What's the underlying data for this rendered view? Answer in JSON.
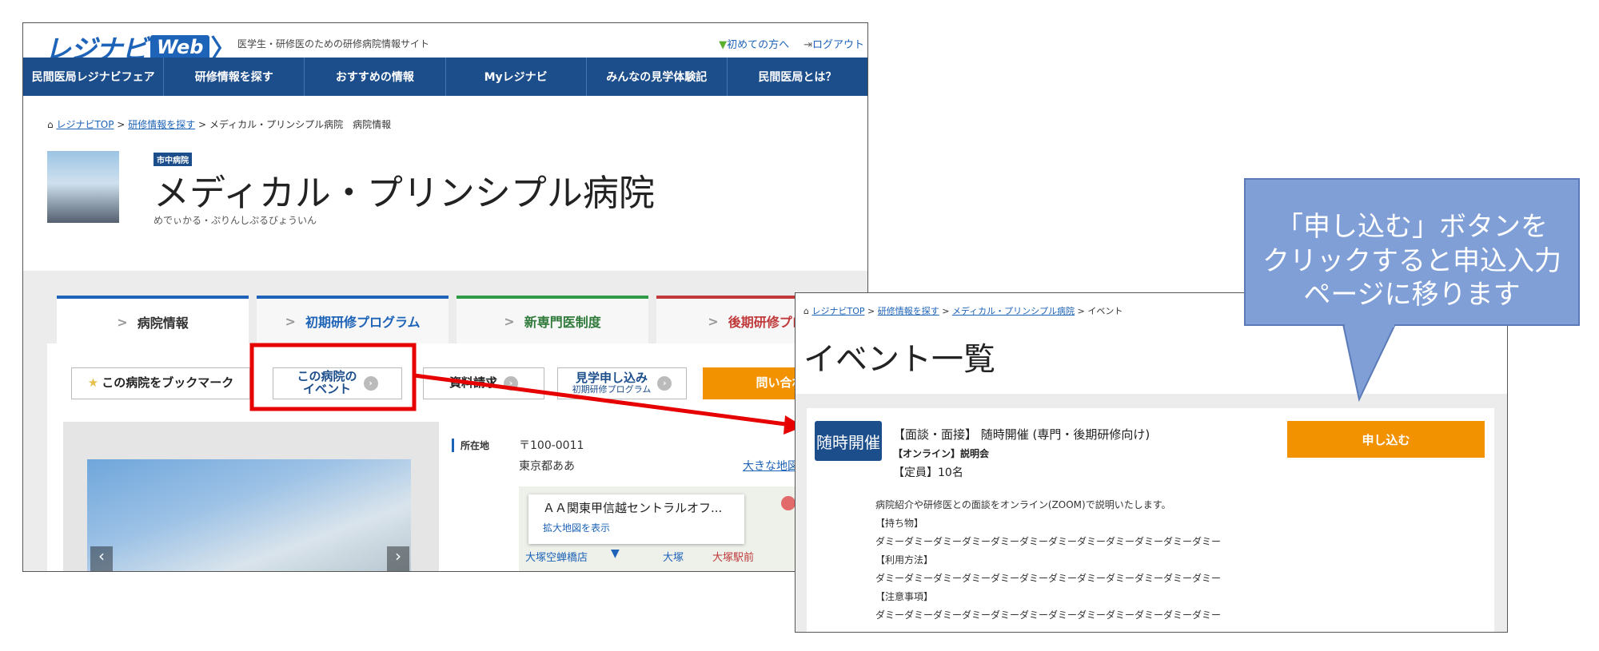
{
  "left": {
    "logo": {
      "kana": "レジナビ",
      "web": "Web",
      "chev": "〉"
    },
    "tagline": "医学生・研修医のための研修病院情報サイト",
    "toplinks": {
      "first_time": "初めての方へ",
      "logout": "ログアウト"
    },
    "nav": [
      "民間医局レジナビフェア",
      "研修情報を探す",
      "おすすめの情報",
      "Myレジナビ",
      "みんなの見学体験記",
      "民間医局とは？"
    ],
    "breadcrumb": {
      "home": "レジナビTOP",
      "sep": ">",
      "search": "研修情報を探す",
      "current": "メディカル・プリンシプル病院　病院情報"
    },
    "badge": "市中病院",
    "hospital_name": "メディカル・プリンシプル病院",
    "hospital_reading": "めでぃかる・ぷりんしぷるびょういん",
    "tabs": [
      "病院情報",
      "初期研修プログラム",
      "新専門医制度",
      "後期研修プログ"
    ],
    "tab_chevron": ">",
    "buttons": {
      "bookmark": "この病院をブックマーク",
      "events_line1": "この病院の",
      "events_line2": "イベント",
      "docs": "資料請求",
      "visit_line1": "見学申し込み",
      "visit_line2": "初期研修プログラム",
      "contact": "問い合わせ"
    },
    "address": {
      "label": "所在地",
      "postal": "〒100-0011",
      "city": "東京都ああ",
      "big_map": "大きな地図"
    },
    "map": {
      "place": "ＡＡ関東甲信越セントラルオフ...",
      "enlarge": "拡大地図を表示",
      "station1": "大塚空蝉橋店",
      "station2": "大塚",
      "station3": "大塚駅前"
    }
  },
  "right": {
    "breadcrumb": {
      "home": "レジナビTOP",
      "search": "研修情報を探す",
      "hospital": "メディカル・プリンシプル病院",
      "current": "イベント"
    },
    "title": "イベント一覧",
    "event": {
      "badge": "随時開催",
      "title": "【面談・面接】 随時開催 (専門・後期研修向け)",
      "subtitle": "【オンライン】説明会",
      "capacity": "【定員】10名",
      "apply": "申し込む",
      "desc": [
        "病院紹介や研修医との面談をオンライン(ZOOM)で説明いたします。",
        "【持ち物】",
        "ダミーダミーダミーダミーダミーダミーダミーダミーダミーダミーダミーダミー",
        "【利用方法】",
        "ダミーダミーダミーダミーダミーダミーダミーダミーダミーダミーダミーダミー",
        "【注意事項】",
        "ダミーダミーダミーダミーダミーダミーダミーダミーダミーダミーダミーダミー"
      ]
    }
  },
  "callout": {
    "lines": [
      "「申し込む」ボタンを",
      "クリックすると申込入力",
      "ページに移ります"
    ]
  },
  "colors": {
    "navy": "#1d4e8c",
    "blue": "#1d63b8",
    "orange": "#f39200",
    "highlight": "#e60000",
    "callout": "#7f9fd6"
  }
}
